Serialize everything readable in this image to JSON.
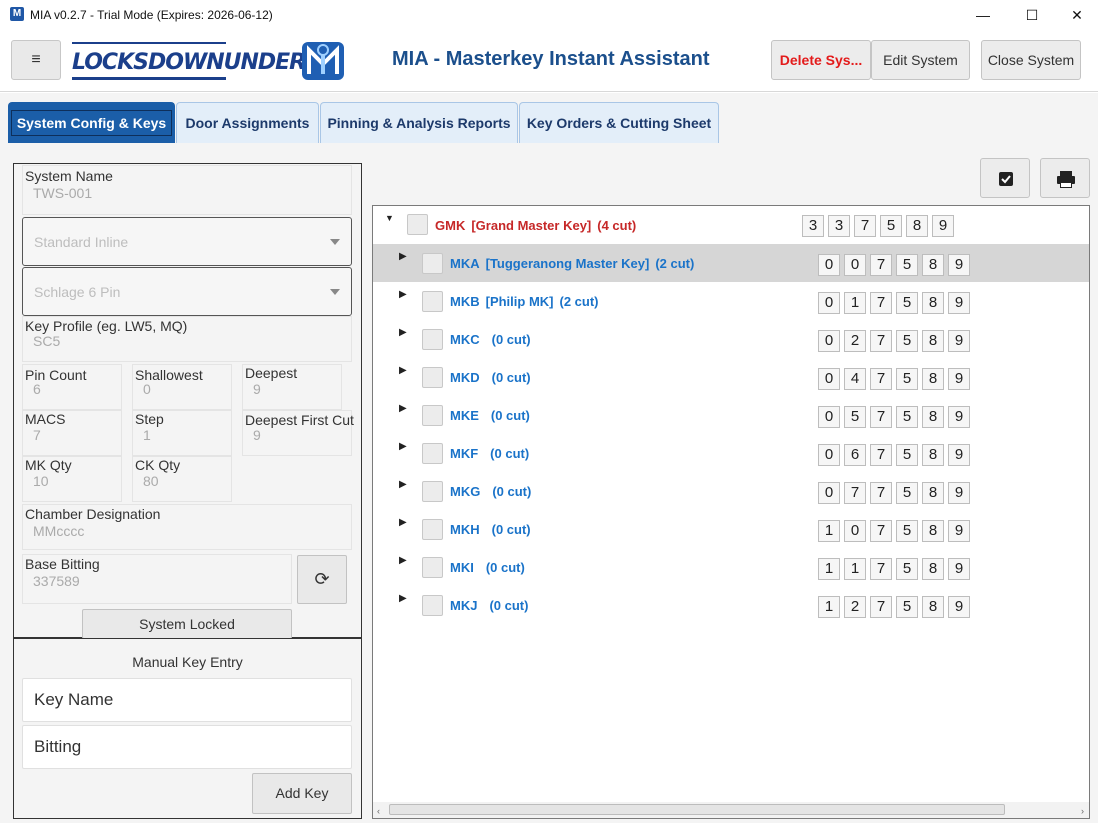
{
  "window": {
    "title": "MIA v0.2.7 - Trial Mode (Expires: 2026-06-12)",
    "minimize": "—",
    "maximize": "☐",
    "close": "✕"
  },
  "header": {
    "menu_icon": "≡",
    "brand_logo": "LOCKSDOWNUNDER",
    "app_title": "MIA - Masterkey Instant Assistant",
    "delete_label": "Delete Sys...",
    "edit_label": "Edit System",
    "close_label": "Close System",
    "delete_color": "#e31b1b",
    "title_color": "#1b4f8c"
  },
  "tabs": [
    {
      "label": "System Config & Keys",
      "active": true
    },
    {
      "label": "Door Assignments",
      "active": false
    },
    {
      "label": "Pinning & Analysis Reports",
      "active": false
    },
    {
      "label": "Key Orders & Cutting Sheet",
      "active": false
    }
  ],
  "config": {
    "system_name": {
      "label": "System Name",
      "value": "TWS-001"
    },
    "keyway_type": "Standard Inline",
    "cylinder": "Schlage 6 Pin",
    "key_profile": {
      "label": "Key Profile (eg. LW5, MQ)",
      "value": "SC5"
    },
    "pin_count": {
      "label": "Pin Count",
      "value": "6"
    },
    "shallowest": {
      "label": "Shallowest",
      "value": "0"
    },
    "deepest": {
      "label": "Deepest",
      "value": "9"
    },
    "macs": {
      "label": "MACS",
      "value": "7"
    },
    "step": {
      "label": "Step",
      "value": "1"
    },
    "deepest_first_cut": {
      "label": "Deepest First Cut",
      "value": "9"
    },
    "mk_qty": {
      "label": "MK Qty",
      "value": "10"
    },
    "ck_qty": {
      "label": "CK Qty",
      "value": "80"
    },
    "chamber": {
      "label": "Chamber Designation",
      "value": "MMcccc"
    },
    "base_bitting": {
      "label": "Base Bitting",
      "value": "337589"
    },
    "refresh_icon": "⟳",
    "lock_button": "System Locked"
  },
  "manual": {
    "title": "Manual Key Entry",
    "key_name_placeholder": "Key Name",
    "bitting_placeholder": "Bitting",
    "add_label": "Add Key"
  },
  "toolbar": {
    "check_icon": "✔",
    "print_icon": "🖶"
  },
  "tree": {
    "root": {
      "code": "GMK",
      "desc": "[Grand Master Key]",
      "count": "(4 cut)",
      "pins": [
        "3",
        "3",
        "7",
        "5",
        "8",
        "9"
      ],
      "color": "#c62828"
    },
    "children": [
      {
        "code": "MKA",
        "desc": "[Tuggeranong Master Key]",
        "count": "(2 cut)",
        "pins": [
          "0",
          "0",
          "7",
          "5",
          "8",
          "9"
        ],
        "selected": true
      },
      {
        "code": "MKB",
        "desc": "[Philip MK]",
        "count": "(2 cut)",
        "pins": [
          "0",
          "1",
          "7",
          "5",
          "8",
          "9"
        ],
        "selected": false
      },
      {
        "code": "MKC",
        "desc": "",
        "count": "(0 cut)",
        "pins": [
          "0",
          "2",
          "7",
          "5",
          "8",
          "9"
        ],
        "selected": false
      },
      {
        "code": "MKD",
        "desc": "",
        "count": "(0 cut)",
        "pins": [
          "0",
          "4",
          "7",
          "5",
          "8",
          "9"
        ],
        "selected": false
      },
      {
        "code": "MKE",
        "desc": "",
        "count": "(0 cut)",
        "pins": [
          "0",
          "5",
          "7",
          "5",
          "8",
          "9"
        ],
        "selected": false
      },
      {
        "code": "MKF",
        "desc": "",
        "count": "(0 cut)",
        "pins": [
          "0",
          "6",
          "7",
          "5",
          "8",
          "9"
        ],
        "selected": false
      },
      {
        "code": "MKG",
        "desc": "",
        "count": "(0 cut)",
        "pins": [
          "0",
          "7",
          "7",
          "5",
          "8",
          "9"
        ],
        "selected": false
      },
      {
        "code": "MKH",
        "desc": "",
        "count": "(0 cut)",
        "pins": [
          "1",
          "0",
          "7",
          "5",
          "8",
          "9"
        ],
        "selected": false
      },
      {
        "code": "MKI",
        "desc": "",
        "count": "(0 cut)",
        "pins": [
          "1",
          "1",
          "7",
          "5",
          "8",
          "9"
        ],
        "selected": false
      },
      {
        "code": "MKJ",
        "desc": "",
        "count": "(0 cut)",
        "pins": [
          "1",
          "2",
          "7",
          "5",
          "8",
          "9"
        ],
        "selected": false
      }
    ],
    "child_color": "#1a73c9"
  }
}
